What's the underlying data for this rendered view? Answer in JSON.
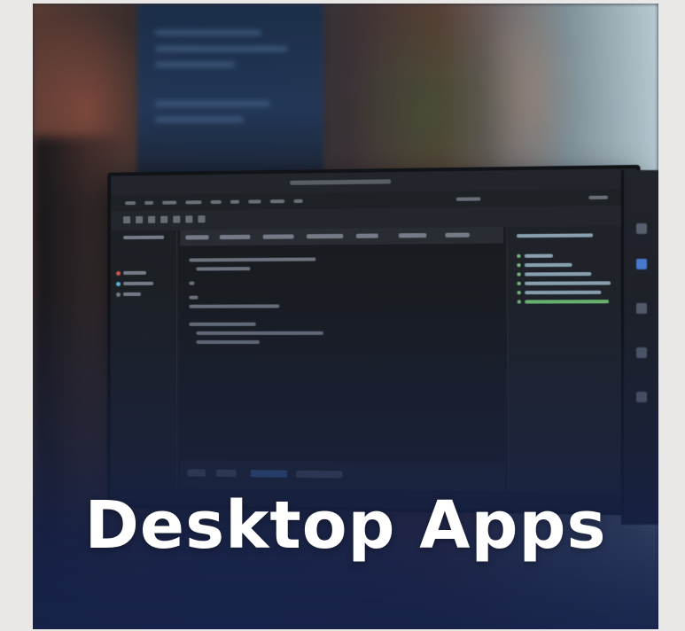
{
  "card": {
    "title": "Desktop Apps"
  },
  "colors": {
    "overlay": "#16224a",
    "title_text": "#ffffff",
    "page_background": "#e9e8e6"
  }
}
